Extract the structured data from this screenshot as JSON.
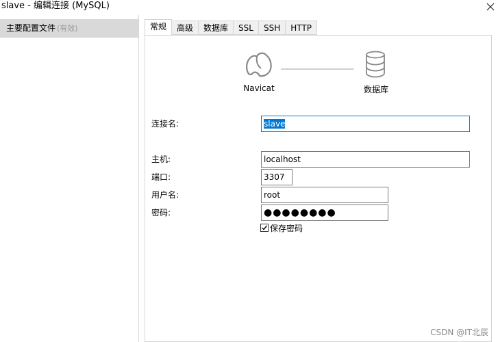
{
  "window": {
    "title": "slave - 编辑连接 (MySQL)",
    "close_icon": "close-icon"
  },
  "sidebar": {
    "items": [
      {
        "label": "主要配置文件",
        "status": "(有效)",
        "selected": true
      }
    ]
  },
  "tabs": [
    {
      "label": "常规",
      "active": true
    },
    {
      "label": "高级",
      "active": false
    },
    {
      "label": "数据库",
      "active": false
    },
    {
      "label": "SSL",
      "active": false
    },
    {
      "label": "SSH",
      "active": false
    },
    {
      "label": "HTTP",
      "active": false
    }
  ],
  "diagram": {
    "left_label": "Navicat",
    "right_label": "数据库"
  },
  "form": {
    "connection_name": {
      "label": "连接名:",
      "value": "slave"
    },
    "host": {
      "label": "主机:",
      "value": "localhost"
    },
    "port": {
      "label": "端口:",
      "value": "3307"
    },
    "username": {
      "label": "用户名:",
      "value": "root"
    },
    "password": {
      "label": "密码:",
      "value": "●●●●●●●●"
    },
    "save_password": {
      "label": "保存密码",
      "checked": true
    }
  },
  "watermark": "CSDN @IT北辰",
  "colors": {
    "accent": "#0078d7",
    "sidebar_selected": "#d9d9d9",
    "tab_inactive": "#f0f0f0"
  }
}
